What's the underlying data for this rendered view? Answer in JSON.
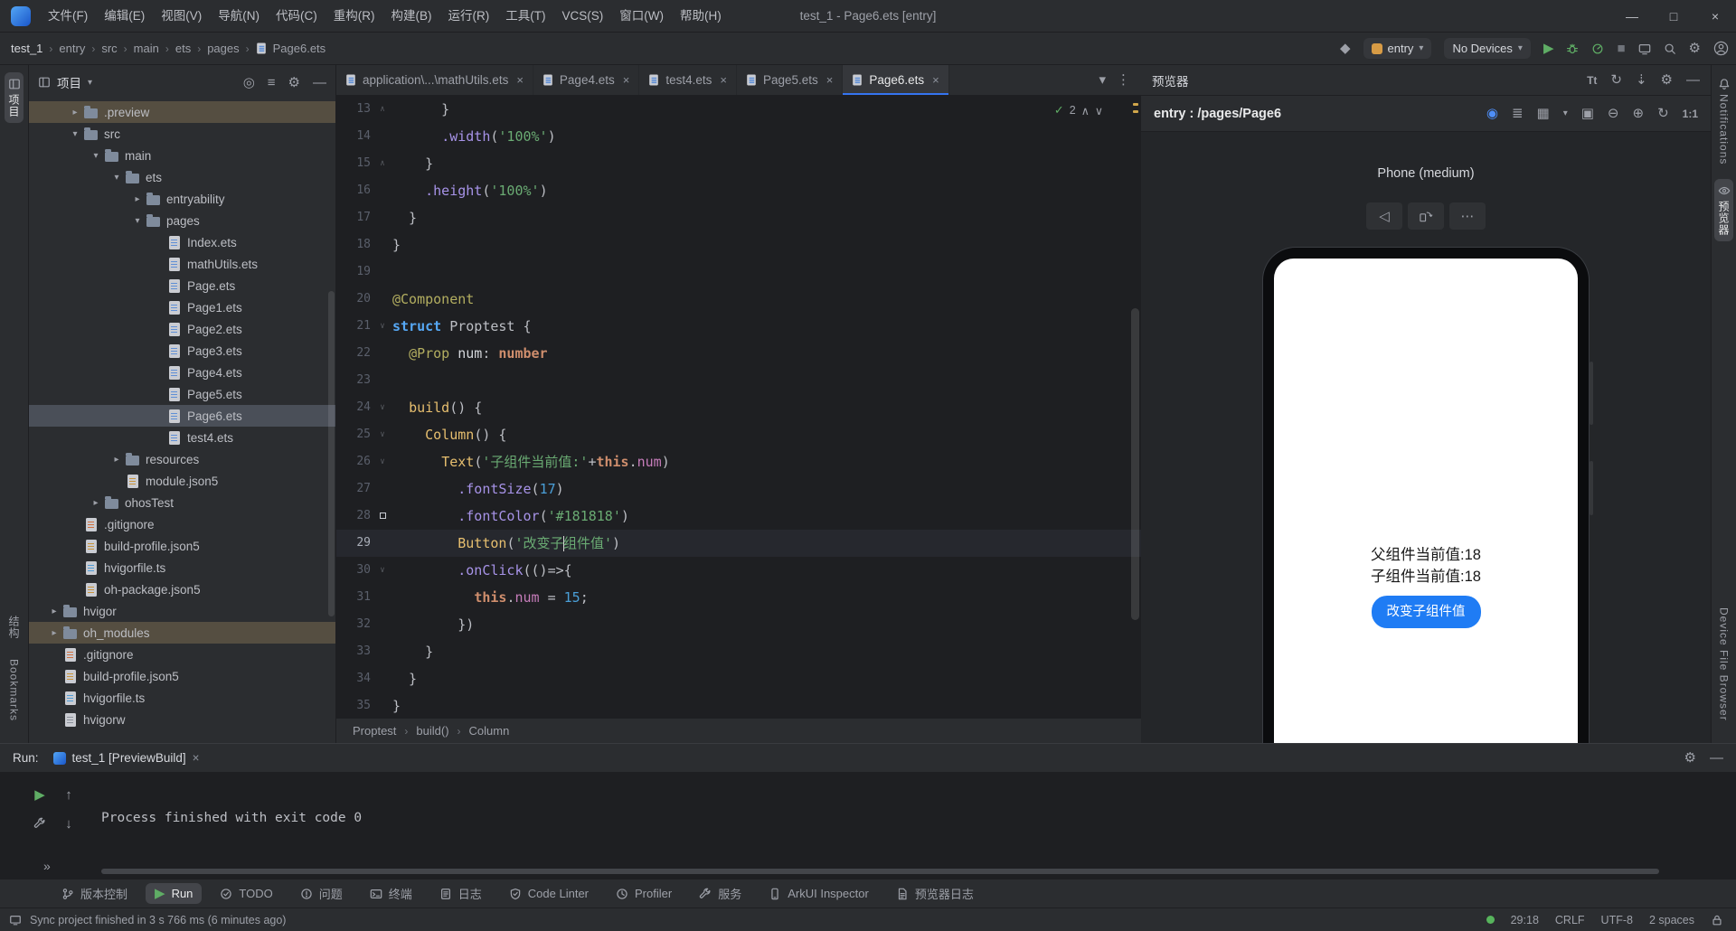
{
  "colors": {
    "accent": "#3574f0",
    "run_green": "#5fad65",
    "status_green": "#57b45c",
    "preview_button_blue": "#1f7cf4"
  },
  "titlebar": {
    "menus": [
      "文件(F)",
      "编辑(E)",
      "视图(V)",
      "导航(N)",
      "代码(C)",
      "重构(R)",
      "构建(B)",
      "运行(R)",
      "工具(T)",
      "VCS(S)",
      "窗口(W)",
      "帮助(H)"
    ],
    "title": "test_1 - Page6.ets [entry]",
    "window_controls": [
      "minimize",
      "maximize",
      "close"
    ]
  },
  "toolbar": {
    "breadcrumbs": [
      "test_1",
      "entry",
      "src",
      "main",
      "ets",
      "pages",
      "Page6.ets"
    ],
    "run_config": "entry",
    "device": "No Devices",
    "actions": [
      {
        "icon": "play",
        "name": "run-button",
        "cls": "green"
      },
      {
        "icon": "debug",
        "name": "debug-button",
        "cls": "green"
      },
      {
        "icon": "profiler-run",
        "name": "profiler-button",
        "cls": "green"
      },
      {
        "icon": "stop",
        "name": "stop-button",
        "cls": "dim2"
      },
      {
        "icon": "devices",
        "name": "device-manager-icon",
        "cls": ""
      },
      {
        "icon": "search",
        "name": "search-icon",
        "cls": ""
      },
      {
        "icon": "gear",
        "name": "settings-icon",
        "cls": ""
      },
      {
        "icon": "avatar",
        "name": "avatar-icon",
        "cls": ""
      }
    ]
  },
  "project": {
    "header": "项目",
    "header_icons": [
      "locate",
      "collapse-all",
      "gear",
      "hide"
    ],
    "items": [
      {
        "l": ".preview",
        "d": 1,
        "t": "folder",
        "c": "c",
        "s": "warm"
      },
      {
        "l": "src",
        "d": 1,
        "t": "folder",
        "c": "e"
      },
      {
        "l": "main",
        "d": 2,
        "t": "folder",
        "c": "e"
      },
      {
        "l": "ets",
        "d": 3,
        "t": "folder",
        "c": "e"
      },
      {
        "l": "entryability",
        "d": 4,
        "t": "folder",
        "c": "c"
      },
      {
        "l": "pages",
        "d": 4,
        "t": "folder",
        "c": "e"
      },
      {
        "l": "Index.ets",
        "d": 5,
        "t": "ets"
      },
      {
        "l": "mathUtils.ets",
        "d": 5,
        "t": "ets"
      },
      {
        "l": "Page.ets",
        "d": 5,
        "t": "ets"
      },
      {
        "l": "Page1.ets",
        "d": 5,
        "t": "ets"
      },
      {
        "l": "Page2.ets",
        "d": 5,
        "t": "ets"
      },
      {
        "l": "Page3.ets",
        "d": 5,
        "t": "ets"
      },
      {
        "l": "Page4.ets",
        "d": 5,
        "t": "ets"
      },
      {
        "l": "Page5.ets",
        "d": 5,
        "t": "ets"
      },
      {
        "l": "Page6.ets",
        "d": 5,
        "t": "ets",
        "s": "sel"
      },
      {
        "l": "test4.ets",
        "d": 5,
        "t": "ets"
      },
      {
        "l": "resources",
        "d": 3,
        "t": "folder",
        "c": "c"
      },
      {
        "l": "module.json5",
        "d": 3,
        "t": "json"
      },
      {
        "l": "ohosTest",
        "d": 2,
        "t": "folder",
        "c": "c"
      },
      {
        "l": ".gitignore",
        "d": 1,
        "t": "git"
      },
      {
        "l": "build-profile.json5",
        "d": 1,
        "t": "json"
      },
      {
        "l": "hvigorfile.ts",
        "d": 1,
        "t": "ts"
      },
      {
        "l": "oh-package.json5",
        "d": 1,
        "t": "json"
      },
      {
        "l": "hvigor",
        "d": 0,
        "t": "folder",
        "c": "c"
      },
      {
        "l": "oh_modules",
        "d": 0,
        "t": "folder",
        "c": "c",
        "s": "warm"
      },
      {
        "l": ".gitignore",
        "d": 0,
        "t": "git"
      },
      {
        "l": "build-profile.json5",
        "d": 0,
        "t": "json"
      },
      {
        "l": "hvigorfile.ts",
        "d": 0,
        "t": "ts"
      },
      {
        "l": "hvigorw",
        "d": 0,
        "t": "file"
      }
    ]
  },
  "editor": {
    "tabs": [
      {
        "label": "application\\...\\mathUtils.ets"
      },
      {
        "label": "Page4.ets"
      },
      {
        "label": "test4.ets"
      },
      {
        "label": "Page5.ets"
      },
      {
        "label": "Page6.ets",
        "active": true
      }
    ],
    "tab_end_icons": [
      "chev-down",
      "more-v"
    ],
    "inspection": {
      "ok_count": "2"
    },
    "breadcrumb": [
      "Proptest",
      "build()",
      "Column"
    ],
    "lines": [
      {
        "n": 13,
        "s": [
          [
            "p",
            "      }"
          ]
        ],
        "fold": "u"
      },
      {
        "n": 14,
        "s": [
          [
            "p",
            "      "
          ],
          [
            "m",
            ".width"
          ],
          [
            "p",
            "("
          ],
          [
            "s",
            "'100%'"
          ],
          [
            "p",
            ")"
          ]
        ]
      },
      {
        "n": 15,
        "s": [
          [
            "p",
            "    }"
          ]
        ],
        "fold": "u"
      },
      {
        "n": 16,
        "s": [
          [
            "p",
            "    "
          ],
          [
            "m",
            ".height"
          ],
          [
            "p",
            "("
          ],
          [
            "s",
            "'100%'"
          ],
          [
            "p",
            ")"
          ]
        ]
      },
      {
        "n": 17,
        "s": [
          [
            "p",
            "  }"
          ]
        ]
      },
      {
        "n": 18,
        "s": [
          [
            "p",
            "}"
          ]
        ]
      },
      {
        "n": 19,
        "s": []
      },
      {
        "n": 20,
        "s": [
          [
            "d",
            "@Component"
          ]
        ]
      },
      {
        "n": 21,
        "s": [
          [
            "k",
            "struct"
          ],
          [
            "p",
            " Proptest {"
          ]
        ],
        "fold": "d"
      },
      {
        "n": 22,
        "s": [
          [
            "p",
            "  "
          ],
          [
            "d",
            "@Prop"
          ],
          [
            "p",
            " "
          ],
          [
            "w",
            "num"
          ],
          [
            "p",
            ": "
          ],
          [
            "o",
            "number"
          ]
        ]
      },
      {
        "n": 23,
        "s": []
      },
      {
        "n": 24,
        "s": [
          [
            "p",
            "  "
          ],
          [
            "f",
            "build"
          ],
          [
            "p",
            "() {"
          ]
        ],
        "fold": "d"
      },
      {
        "n": 25,
        "s": [
          [
            "p",
            "    "
          ],
          [
            "f",
            "Column"
          ],
          [
            "p",
            "() {"
          ]
        ],
        "fold": "d"
      },
      {
        "n": 26,
        "s": [
          [
            "p",
            "      "
          ],
          [
            "f",
            "Text"
          ],
          [
            "p",
            "("
          ],
          [
            "s",
            "'子组件当前值:'"
          ],
          [
            "p",
            "+"
          ],
          [
            "o",
            "this"
          ],
          [
            "p",
            "."
          ],
          [
            "i",
            "num"
          ],
          [
            "p",
            ")"
          ]
        ],
        "fold": "d"
      },
      {
        "n": 27,
        "s": [
          [
            "p",
            "        "
          ],
          [
            "m",
            ".fontSize"
          ],
          [
            "p",
            "("
          ],
          [
            "n2",
            "17"
          ],
          [
            "p",
            ")"
          ]
        ]
      },
      {
        "n": 28,
        "s": [
          [
            "p",
            "        "
          ],
          [
            "m",
            ".fontColor"
          ],
          [
            "p",
            "("
          ],
          [
            "s",
            "'#181818'"
          ],
          [
            "p",
            ")"
          ]
        ],
        "mark": "square"
      },
      {
        "n": 29,
        "s": [
          [
            "p",
            "        "
          ],
          [
            "f",
            "Button"
          ],
          [
            "p",
            "("
          ],
          [
            "s",
            "'改变子"
          ],
          [
            "caret",
            ""
          ],
          [
            "s",
            "组件值'"
          ],
          [
            "p",
            ")"
          ]
        ],
        "cur": true
      },
      {
        "n": 30,
        "s": [
          [
            "p",
            "        "
          ],
          [
            "m",
            ".onClick"
          ],
          [
            "p",
            "(()=>{"
          ]
        ],
        "fold": "d"
      },
      {
        "n": 31,
        "s": [
          [
            "p",
            "          "
          ],
          [
            "o",
            "this"
          ],
          [
            "p",
            "."
          ],
          [
            "i",
            "num"
          ],
          [
            "p",
            " = "
          ],
          [
            "n2",
            "15"
          ],
          [
            "p",
            ";"
          ]
        ]
      },
      {
        "n": 32,
        "s": [
          [
            "p",
            "        })"
          ]
        ]
      },
      {
        "n": 33,
        "s": [
          [
            "p",
            "    }"
          ]
        ]
      },
      {
        "n": 34,
        "s": [
          [
            "p",
            "  }"
          ]
        ]
      },
      {
        "n": 35,
        "s": [
          [
            "p",
            "}"
          ]
        ]
      }
    ]
  },
  "previewer": {
    "title": "预览器",
    "header_icons": [
      "font-size",
      "refresh",
      "collapse",
      "gear",
      "hide"
    ],
    "target": "entry : /pages/Page6",
    "toolbar_icons": [
      "inspect",
      "layers",
      "grid",
      "chev-down",
      "frame",
      "zoom-out",
      "zoom-in",
      "refresh",
      "one-to-one"
    ],
    "device_label": "Phone (medium)",
    "device_controls": [
      "back",
      "rotate-device",
      "more-h"
    ],
    "screen": {
      "line1": "父组件当前值:18",
      "line2": "子组件当前值:18",
      "button_label": "改变子组件值"
    }
  },
  "run": {
    "label": "Run:",
    "tab": "test_1 [PreviewBuild]",
    "tools": [
      "play",
      "up",
      "wrench",
      "down"
    ],
    "head_icons": [
      "gear",
      "hide"
    ],
    "output": "Process finished with exit code 0"
  },
  "bottom_toolbar": [
    {
      "label": "版本控制",
      "icon": "branch"
    },
    {
      "label": "Run",
      "icon": "run",
      "active": true
    },
    {
      "label": "TODO",
      "icon": "todo"
    },
    {
      "label": "问题",
      "icon": "problems"
    },
    {
      "label": "终端",
      "icon": "terminal"
    },
    {
      "label": "日志",
      "icon": "logs"
    },
    {
      "label": "Code Linter",
      "icon": "linter"
    },
    {
      "label": "Profiler",
      "icon": "profiler"
    },
    {
      "label": "服务",
      "icon": "services"
    },
    {
      "label": "ArkUI Inspector",
      "icon": "arkui"
    },
    {
      "label": "预览器日志",
      "icon": "prevlog"
    }
  ],
  "statusbar": {
    "sync": "Sync project finished in 3 s 766 ms (6 minutes ago)",
    "caret_pos": "29:18",
    "line_ending": "CRLF",
    "encoding": "UTF-8",
    "indent": "2 spaces"
  },
  "strips": {
    "left_top": [
      {
        "label": "项目",
        "icon": "tree",
        "active": true
      }
    ],
    "left_bottom": [
      {
        "label": "结构",
        "icon": null
      },
      {
        "label": "Bookmarks",
        "icon": null
      }
    ],
    "right_top": [
      {
        "label": "Notifications",
        "icon": "bell"
      },
      {
        "label": "预览器",
        "icon": "eye",
        "active": true
      }
    ],
    "right_bottom": [
      {
        "label": "Device File Browser",
        "icon": null
      }
    ]
  }
}
